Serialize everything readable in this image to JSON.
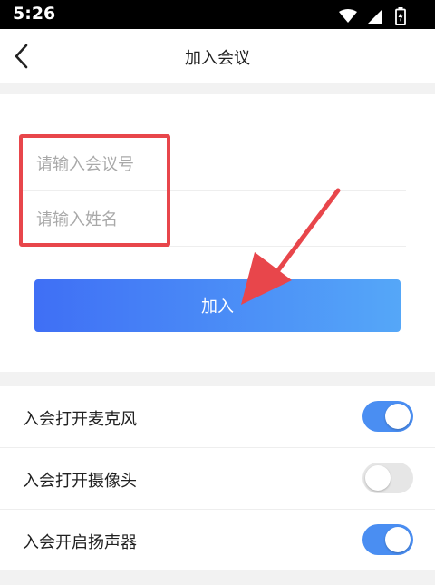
{
  "status_bar": {
    "time": "5:26",
    "icons": [
      "wifi-icon",
      "cell-signal-icon",
      "battery-charging-icon"
    ]
  },
  "header": {
    "title": "加入会议",
    "back_icon": "chevron-left-icon"
  },
  "form": {
    "meeting_id_placeholder": "请输入会议号",
    "meeting_id_value": "",
    "name_placeholder": "请输入姓名",
    "name_value": "",
    "join_label": "加入"
  },
  "settings": [
    {
      "label": "入会打开麦克风",
      "enabled": true
    },
    {
      "label": "入会打开摄像头",
      "enabled": false
    },
    {
      "label": "入会开启扬声器",
      "enabled": true
    }
  ],
  "colors": {
    "accent_start": "#3f6ff5",
    "accent_end": "#55a7f8",
    "toggle_on": "#4a8ef2",
    "toggle_off": "#e6e6e6",
    "annotation_red": "#e8464b"
  }
}
